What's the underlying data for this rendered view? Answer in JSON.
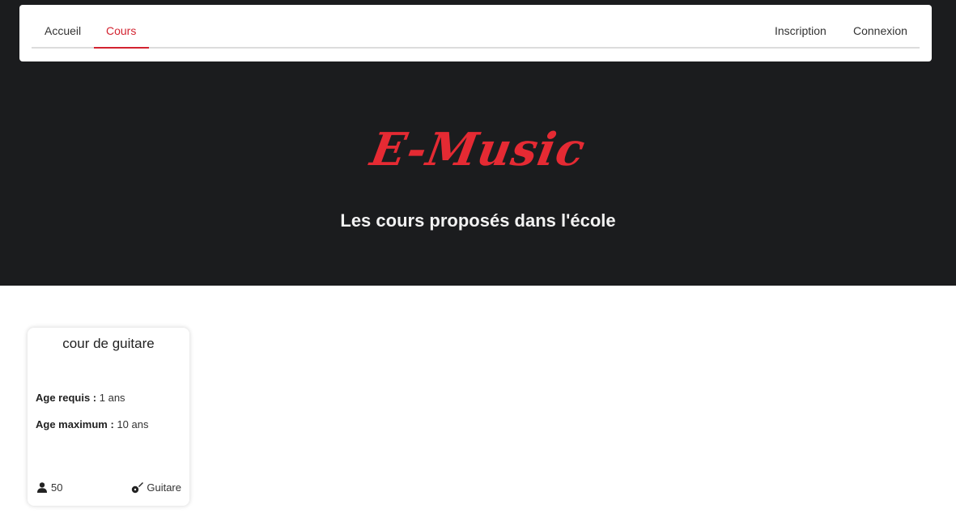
{
  "nav": {
    "items_left": [
      {
        "label": "Accueil",
        "active": false
      },
      {
        "label": "Cours",
        "active": true
      }
    ],
    "items_right": [
      {
        "label": "Inscription"
      },
      {
        "label": "Connexion"
      }
    ],
    "accent_color": "#d32330"
  },
  "hero": {
    "logo_text": "E-Music",
    "subtitle": "Les cours proposés dans l'école",
    "background_color": "#1b1c1e",
    "logo_color": "#e52a33"
  },
  "courses": [
    {
      "title": "cour de guitare",
      "age_min_label": "Age requis :",
      "age_min_value": "1 ans",
      "age_max_label": "Age maximum :",
      "age_max_value": "10 ans",
      "capacity": "50",
      "capacity_icon": "user-icon",
      "instrument": "Guitare",
      "instrument_icon": "guitar-icon"
    }
  ]
}
